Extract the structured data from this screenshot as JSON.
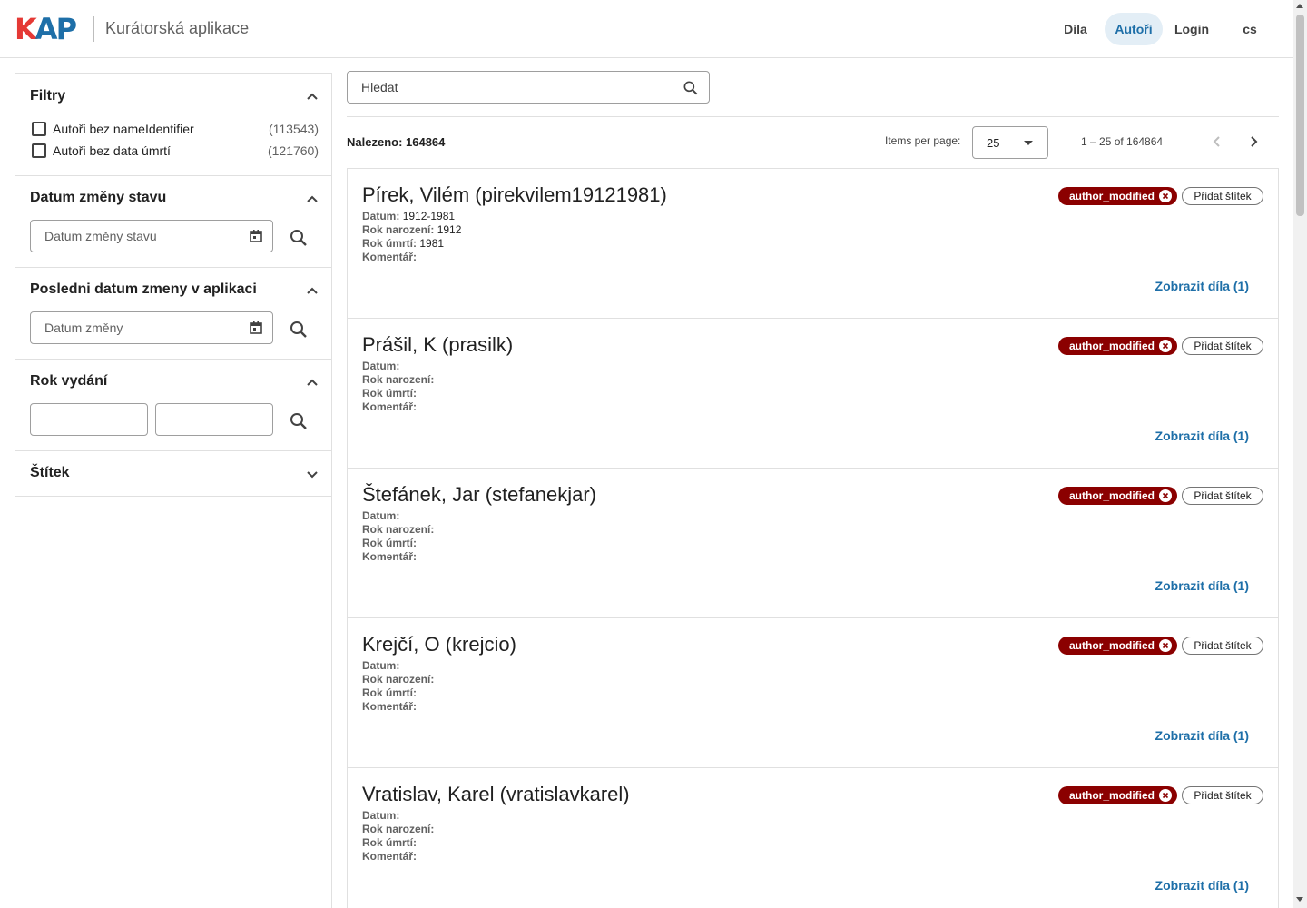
{
  "header": {
    "logo_k": "K",
    "logo_ap": "AP",
    "app_title": "Kurátorská aplikace",
    "nav": {
      "dila": "Díla",
      "autori": "Autoři",
      "login": "Login",
      "lang": "cs"
    }
  },
  "colors": {
    "accent": "#1e6fa8",
    "logo_red": "#e53935",
    "tag_bg": "#8b0000",
    "active_nav_bg": "#e3eef6"
  },
  "sidebar": {
    "filters_title": "Filtry",
    "filters": [
      {
        "label": "Autoři bez nameIdentifier",
        "count": "(113543)"
      },
      {
        "label": "Autoři bez data úmrtí",
        "count": "(121760)"
      }
    ],
    "status_date": {
      "title": "Datum změny stavu",
      "placeholder": "Datum změny stavu"
    },
    "app_date": {
      "title": "Posledni datum zmeny v aplikaci",
      "placeholder": "Datum změny"
    },
    "year": {
      "title": "Rok vydání"
    },
    "tag": {
      "title": "Štítek"
    }
  },
  "search": {
    "placeholder": "Hledat"
  },
  "results": {
    "found_label": "Nalezeno: 164864",
    "ipp_label": "Items per page:",
    "ipp_value": "25",
    "range": "1 – 25 of 164864"
  },
  "labels": {
    "datum": "Datum:",
    "rok_narozeni": "Rok narození:",
    "rok_umrti": "Rok úmrtí:",
    "komentar": "Komentář:",
    "add_tag": "Přidat štítek",
    "tag_name": "author_modified",
    "show_works": "Zobrazit díla (1)"
  },
  "authors": [
    {
      "name": "Pírek, Vilém (pirekvilem19121981)",
      "datum": "1912-1981",
      "narozeni": "1912",
      "umrti": "1981",
      "komentar": ""
    },
    {
      "name": "Prášil, K (prasilk)",
      "datum": "",
      "narozeni": "",
      "umrti": "",
      "komentar": ""
    },
    {
      "name": "Štefánek, Jar (stefanekjar)",
      "datum": "",
      "narozeni": "",
      "umrti": "",
      "komentar": ""
    },
    {
      "name": "Krejčí, O (krejcio)",
      "datum": "",
      "narozeni": "",
      "umrti": "",
      "komentar": ""
    },
    {
      "name": "Vratislav, Karel (vratislavkarel)",
      "datum": "",
      "narozeni": "",
      "umrti": "",
      "komentar": ""
    }
  ]
}
